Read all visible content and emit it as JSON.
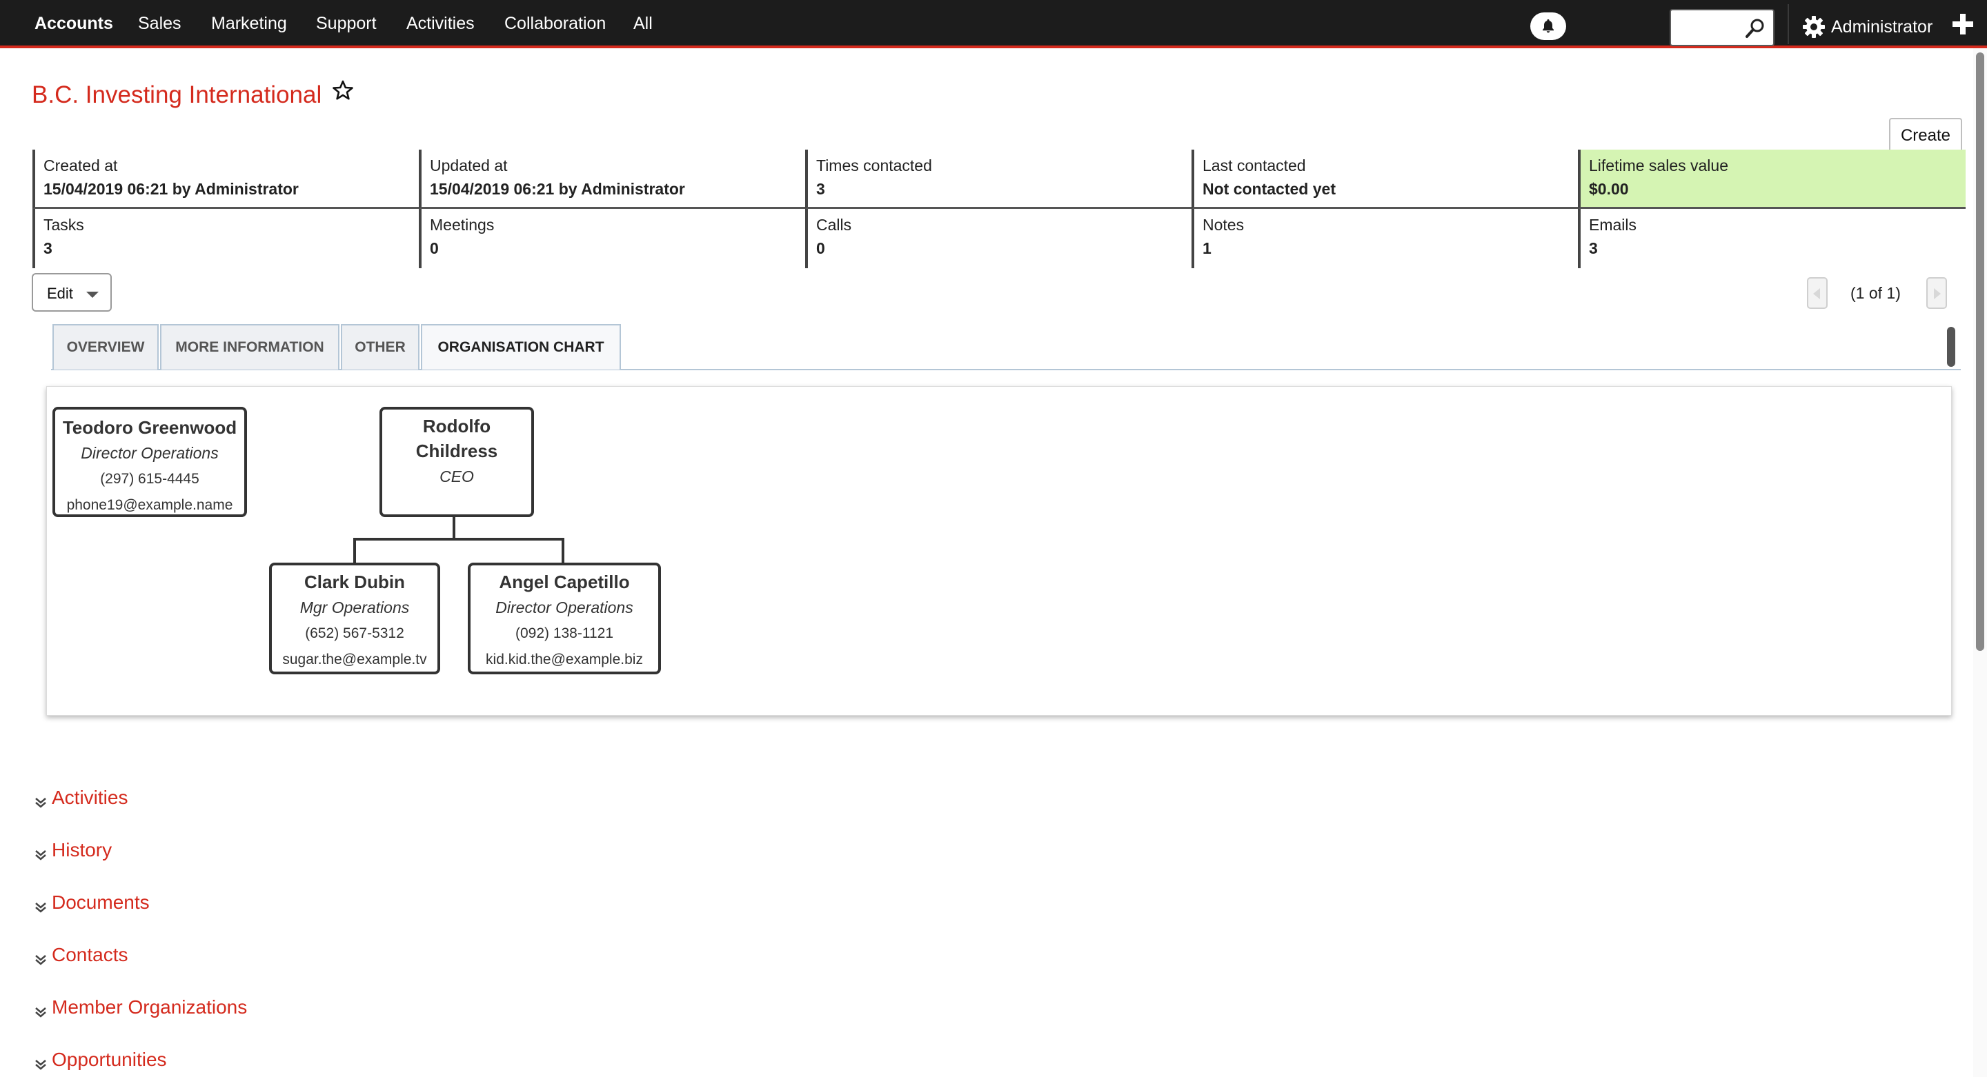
{
  "nav": {
    "items": [
      {
        "label": "Accounts",
        "active": true
      },
      {
        "label": "Sales"
      },
      {
        "label": "Marketing"
      },
      {
        "label": "Support"
      },
      {
        "label": "Activities"
      },
      {
        "label": "Collaboration"
      },
      {
        "label": "All"
      }
    ],
    "user_label": "Administrator",
    "search_value": "",
    "icons": [
      "bell-icon",
      "search-icon",
      "gear-icon",
      "plus-icon"
    ]
  },
  "header": {
    "title": "B.C. Investing International",
    "create_label": "Create"
  },
  "stats": {
    "top": [
      {
        "label": "Created at",
        "value": "15/04/2019 06:21 by Administrator"
      },
      {
        "label": "Updated at",
        "value": "15/04/2019 06:21 by Administrator"
      },
      {
        "label": "Times contacted",
        "value": "3"
      },
      {
        "label": "Last contacted",
        "value": "Not contacted yet"
      },
      {
        "label": "Lifetime sales value",
        "value": "$0.00"
      }
    ],
    "bottom": [
      {
        "label": "Tasks",
        "value": "3"
      },
      {
        "label": "Meetings",
        "value": "0"
      },
      {
        "label": "Calls",
        "value": "0"
      },
      {
        "label": "Notes",
        "value": "1"
      },
      {
        "label": "Emails",
        "value": "3"
      }
    ],
    "highlight_color": "#d5f4b3"
  },
  "actions": {
    "edit_label": "Edit",
    "pager_text": "(1 of 1)"
  },
  "tabs": [
    {
      "label": "OVERVIEW"
    },
    {
      "label": "MORE INFORMATION"
    },
    {
      "label": "OTHER"
    },
    {
      "label": "ORGANISATION CHART",
      "active": true
    }
  ],
  "org_chart": {
    "standalone": {
      "name": "Teodoro Greenwood",
      "title": "Director Operations",
      "phone": "(297) 615-4445",
      "email": "phone19@example.name"
    },
    "root": {
      "name_line1": "Rodolfo",
      "name_line2": "Childress",
      "title": "CEO"
    },
    "reports": [
      {
        "name": "Clark Dubin",
        "title": "Mgr Operations",
        "phone": "(652) 567-5312",
        "email": "sugar.the@example.tv"
      },
      {
        "name": "Angel Capetillo",
        "title": "Director Operations",
        "phone": "(092) 138-1121",
        "email": "kid.kid.the@example.biz"
      }
    ]
  },
  "sections": [
    {
      "label": "Activities"
    },
    {
      "label": "History"
    },
    {
      "label": "Documents"
    },
    {
      "label": "Contacts"
    },
    {
      "label": "Member Organizations"
    },
    {
      "label": "Opportunities"
    }
  ],
  "colors": {
    "accent": "#d42a1d",
    "nav_bg": "#1c1c1c"
  }
}
